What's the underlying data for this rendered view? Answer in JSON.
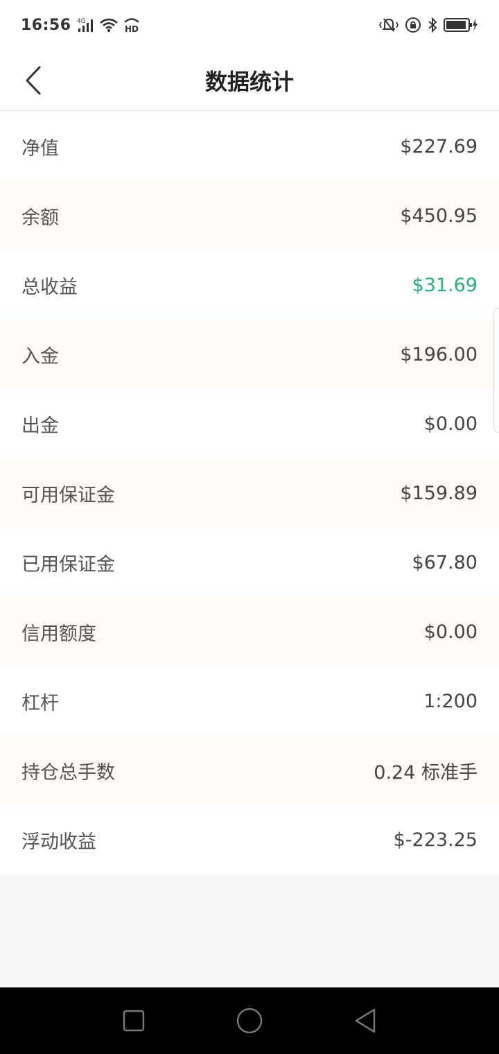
{
  "status_bar": {
    "time": "16:56",
    "network_label": "4G",
    "hd_label": "HD"
  },
  "header": {
    "title": "数据统计"
  },
  "stats": [
    {
      "label": "净值",
      "value": "$227.69",
      "tone": "normal"
    },
    {
      "label": "余额",
      "value": "$450.95",
      "tone": "normal"
    },
    {
      "label": "总收益",
      "value": "$31.69",
      "tone": "positive"
    },
    {
      "label": "入金",
      "value": "$196.00",
      "tone": "normal"
    },
    {
      "label": "出金",
      "value": "$0.00",
      "tone": "normal"
    },
    {
      "label": "可用保证金",
      "value": "$159.89",
      "tone": "normal"
    },
    {
      "label": "已用保证金",
      "value": "$67.80",
      "tone": "normal"
    },
    {
      "label": "信用额度",
      "value": "$0.00",
      "tone": "normal"
    },
    {
      "label": "杠杆",
      "value": "1:200",
      "tone": "normal"
    },
    {
      "label": "持仓总手数",
      "value": "0.24 标准手",
      "tone": "normal"
    },
    {
      "label": "浮动收益",
      "value": "$-223.25",
      "tone": "normal"
    }
  ],
  "colors": {
    "positive": "#1fb37a",
    "row_alt": "#fffaf6",
    "nav_bar": "#000000"
  },
  "icons": {
    "back": "back-arrow-icon",
    "nav_recent": "square-icon",
    "nav_home": "circle-icon",
    "nav_back": "triangle-back-icon"
  }
}
